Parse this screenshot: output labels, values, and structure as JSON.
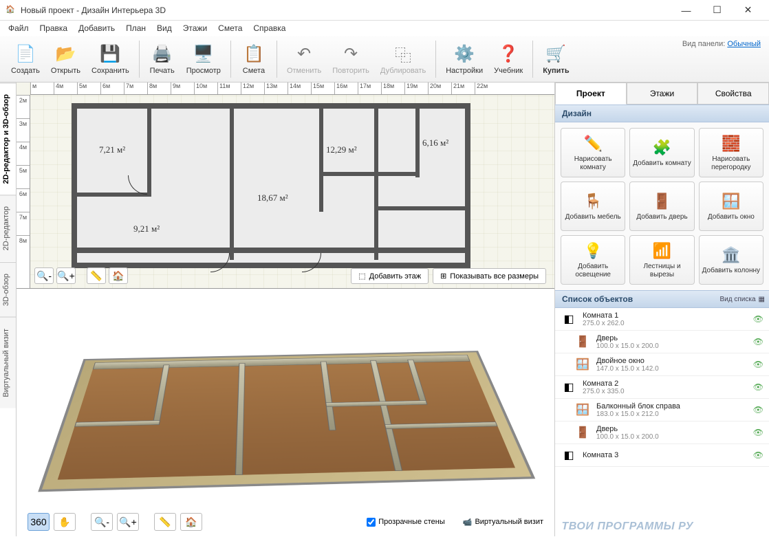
{
  "window": {
    "title": "Новый проект - Дизайн Интерьера 3D"
  },
  "menu": [
    "Файл",
    "Правка",
    "Добавить",
    "План",
    "Вид",
    "Этажи",
    "Смета",
    "Справка"
  ],
  "toolbar": {
    "create": "Создать",
    "open": "Открыть",
    "save": "Сохранить",
    "print": "Печать",
    "preview": "Просмотр",
    "estimate": "Смета",
    "undo": "Отменить",
    "redo": "Повторить",
    "duplicate": "Дублировать",
    "settings": "Настройки",
    "tutorial": "Учебник",
    "buy": "Купить",
    "panel_label": "Вид панели:",
    "panel_mode": "Обычный"
  },
  "left_tabs": [
    "2D-редактор и 3D-обзор",
    "2D-редактор",
    "3D-обзор",
    "Виртуальный визит"
  ],
  "ruler_h": [
    "м",
    "4м",
    "5м",
    "6м",
    "7м",
    "8м",
    "9м",
    "10м",
    "11м",
    "12м",
    "13м",
    "14м",
    "15м",
    "16м",
    "17м",
    "18м",
    "19м",
    "20м",
    "21м",
    "22м"
  ],
  "ruler_v": [
    "2м",
    "3м",
    "4м",
    "5м",
    "6м",
    "7м",
    "8м"
  ],
  "rooms": {
    "r1": "7,21 м²",
    "r2": "18,67 м²",
    "r3": "12,29 м²",
    "r4": "6,16 м²",
    "r5": "9,21 м²"
  },
  "plan_actions": {
    "add_floor": "Добавить этаж",
    "show_sizes": "Показывать все размеры"
  },
  "view3d": {
    "transparent": "Прозрачные стены",
    "camera": "Виртуальный визит"
  },
  "right": {
    "tabs": [
      "Проект",
      "Этажи",
      "Свойства"
    ],
    "design_header": "Дизайн",
    "buttons": [
      {
        "icon": "✏️",
        "label": "Нарисовать комнату"
      },
      {
        "icon": "🧩",
        "label": "Добавить комнату"
      },
      {
        "icon": "🧱",
        "label": "Нарисовать перегородку"
      },
      {
        "icon": "🪑",
        "label": "Добавить мебель"
      },
      {
        "icon": "🚪",
        "label": "Добавить дверь"
      },
      {
        "icon": "🪟",
        "label": "Добавить окно"
      },
      {
        "icon": "💡",
        "label": "Добавить освещение"
      },
      {
        "icon": "📶",
        "label": "Лестницы и вырезы"
      },
      {
        "icon": "🏛️",
        "label": "Добавить колонну"
      }
    ],
    "objects_header": "Список объектов",
    "list_mode": "Вид списка",
    "objects": [
      {
        "icon": "◧",
        "name": "Комната 1",
        "dim": "275.0 x 262.0",
        "child": false
      },
      {
        "icon": "🚪",
        "name": "Дверь",
        "dim": "100.0 x 15.0 x 200.0",
        "child": true
      },
      {
        "icon": "🪟",
        "name": "Двойное окно",
        "dim": "147.0 x 15.0 x 142.0",
        "child": true
      },
      {
        "icon": "◧",
        "name": "Комната 2",
        "dim": "275.0 x 335.0",
        "child": false
      },
      {
        "icon": "🪟",
        "name": "Балконный блок справа",
        "dim": "183.0 x 15.0 x 212.0",
        "child": true
      },
      {
        "icon": "🚪",
        "name": "Дверь",
        "dim": "100.0 x 15.0 x 200.0",
        "child": true
      },
      {
        "icon": "◧",
        "name": "Комната 3",
        "dim": "",
        "child": false
      }
    ]
  },
  "watermark": "ТВОИ ПРОГРАММЫ РУ"
}
